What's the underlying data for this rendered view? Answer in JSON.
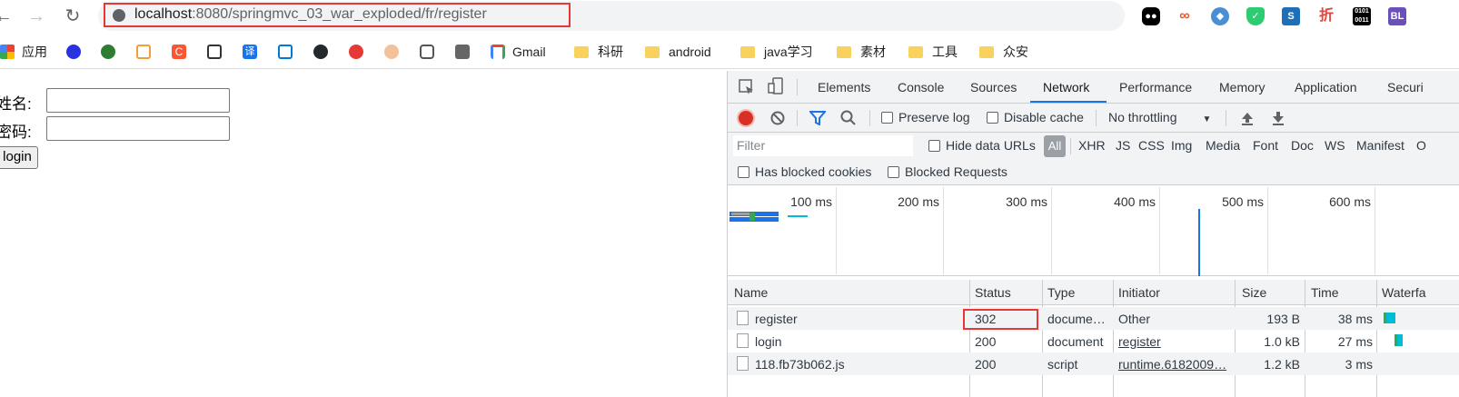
{
  "browser": {
    "url_host": "localhost",
    "url_rest": ":8080/springmvc_03_war_exploded/fr/register",
    "extensions": [
      "tampermonkey",
      "infinity",
      "shield",
      "adguard",
      "s-logo",
      "zhe",
      "binary",
      "BL"
    ]
  },
  "bookmarks": {
    "apps": "应用",
    "gmail": "Gmail",
    "folders": [
      "科研",
      "android",
      "java学习",
      "素材",
      "工具",
      "众安"
    ]
  },
  "page": {
    "name_label": "姓名:",
    "password_label": "密码:",
    "login_label": "login"
  },
  "devtools": {
    "tabs": [
      "Elements",
      "Console",
      "Sources",
      "Network",
      "Performance",
      "Memory",
      "Application",
      "Securi"
    ],
    "active_tab": "Network",
    "toolbar": {
      "preserve_log": "Preserve log",
      "disable_cache": "Disable cache",
      "throttling": "No throttling"
    },
    "filter": {
      "placeholder": "Filter",
      "hide_data_urls": "Hide data URLs",
      "types": [
        "All",
        "XHR",
        "JS",
        "CSS",
        "Img",
        "Media",
        "Font",
        "Doc",
        "WS",
        "Manifest",
        "O"
      ]
    },
    "blocked": {
      "has_blocked_cookies": "Has blocked cookies",
      "blocked_requests": "Blocked Requests"
    },
    "timeline_ticks": [
      "100 ms",
      "200 ms",
      "300 ms",
      "400 ms",
      "500 ms",
      "600 ms"
    ],
    "columns": [
      "Name",
      "Status",
      "Type",
      "Initiator",
      "Size",
      "Time",
      "Waterfa"
    ],
    "rows": [
      {
        "name": "register",
        "status": "302",
        "type": "docume…",
        "initiator": "Other",
        "size": "193 B",
        "time": "38 ms"
      },
      {
        "name": "login",
        "status": "200",
        "type": "document",
        "initiator": "register",
        "size": "1.0 kB",
        "time": "27 ms"
      },
      {
        "name": "118.fb73b062.js",
        "status": "200",
        "type": "script",
        "initiator": "runtime.6182009…",
        "size": "1.2 kB",
        "time": "3 ms"
      }
    ]
  },
  "colors": {
    "highlight": "#e53935",
    "accent": "#1a73e8",
    "record": "#d93025"
  }
}
